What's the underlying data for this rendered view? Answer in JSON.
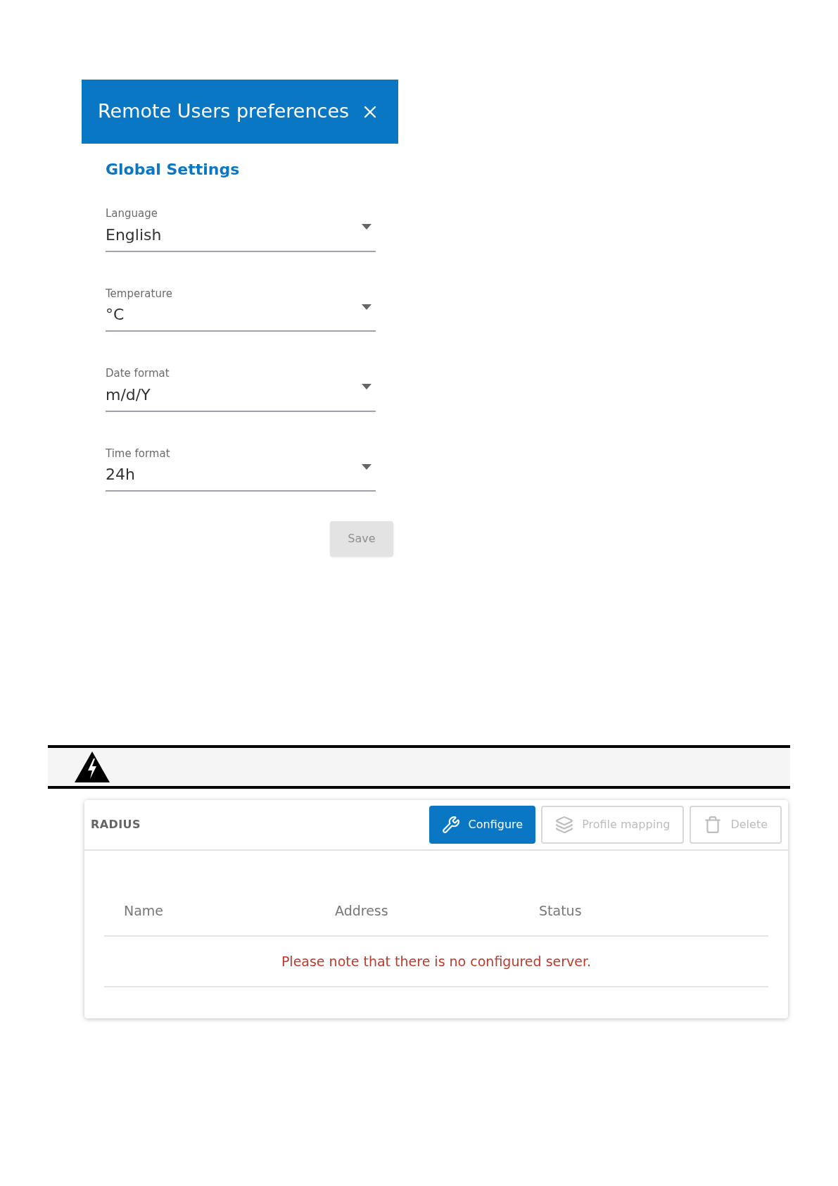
{
  "dialog": {
    "title": "Remote Users preferences",
    "section_title": "Global Settings",
    "fields": [
      {
        "label": "Language",
        "value": "English"
      },
      {
        "label": "Temperature",
        "value": "°C"
      },
      {
        "label": "Date format",
        "value": "m/d/Y"
      },
      {
        "label": "Time format",
        "value": "24h"
      }
    ],
    "save_button": {
      "label": "Save",
      "disabled": true
    }
  },
  "radius": {
    "title": "RADIUS",
    "buttons": [
      {
        "label": "Configure",
        "kind": "configure",
        "disabled": false
      },
      {
        "label": "Profile mapping",
        "kind": "mapping",
        "disabled": true
      },
      {
        "label": "Delete",
        "kind": "delete",
        "disabled": true
      }
    ],
    "table": {
      "columns": [
        "Name",
        "Address",
        "Status"
      ],
      "empty_message": "Please note that there is no configured server."
    }
  }
}
